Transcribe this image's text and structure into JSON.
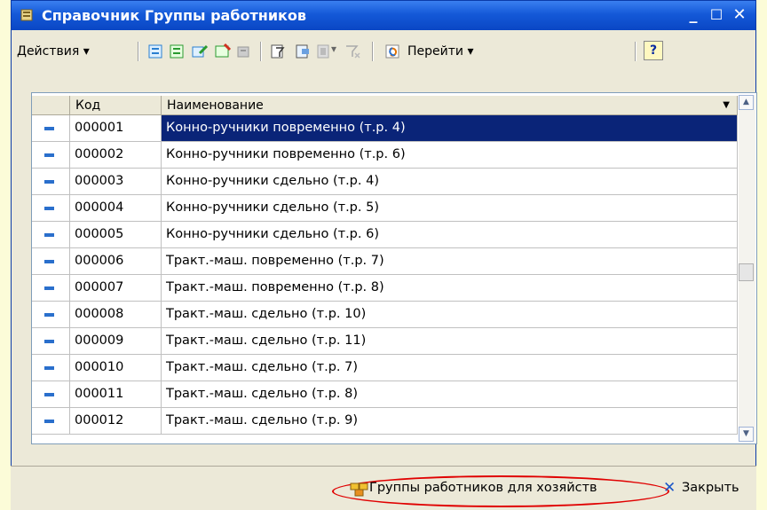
{
  "window": {
    "title": "Справочник Группы работников"
  },
  "toolbar": {
    "actions_label": "Действия",
    "goto_label": "Перейти",
    "help_label": "?"
  },
  "table": {
    "columns": [
      "Код",
      "Наименование"
    ],
    "rows": [
      {
        "code": "000001",
        "name": "Конно-ручники повременно (т.р. 4)"
      },
      {
        "code": "000002",
        "name": "Конно-ручники повременно (т.р. 6)"
      },
      {
        "code": "000003",
        "name": "Конно-ручники сдельно (т.р. 4)"
      },
      {
        "code": "000004",
        "name": "Конно-ручники сдельно (т.р. 5)"
      },
      {
        "code": "000005",
        "name": "Конно-ручники сдельно (т.р. 6)"
      },
      {
        "code": "000006",
        "name": "Тракт.-маш. повременно (т.р. 7)"
      },
      {
        "code": "000007",
        "name": "Тракт.-маш. повременно (т.р. 8)"
      },
      {
        "code": "000008",
        "name": "Тракт.-маш. сдельно (т.р. 10)"
      },
      {
        "code": "000009",
        "name": "Тракт.-маш. сдельно (т.р. 11)"
      },
      {
        "code": "000010",
        "name": "Тракт.-маш. сдельно (т.р. 7)"
      },
      {
        "code": "000011",
        "name": "Тракт.-маш. сдельно (т.р. 8)"
      },
      {
        "code": "000012",
        "name": "Тракт.-маш. сдельно (т.р. 9)"
      }
    ]
  },
  "statusbar": {
    "groups_button_label": "Группы работников для хозяйств",
    "close_label": "Закрыть"
  },
  "colors": {
    "title_bar": "#1459d8",
    "selection": "#0a2478",
    "highlight_oval": "#e00000"
  }
}
